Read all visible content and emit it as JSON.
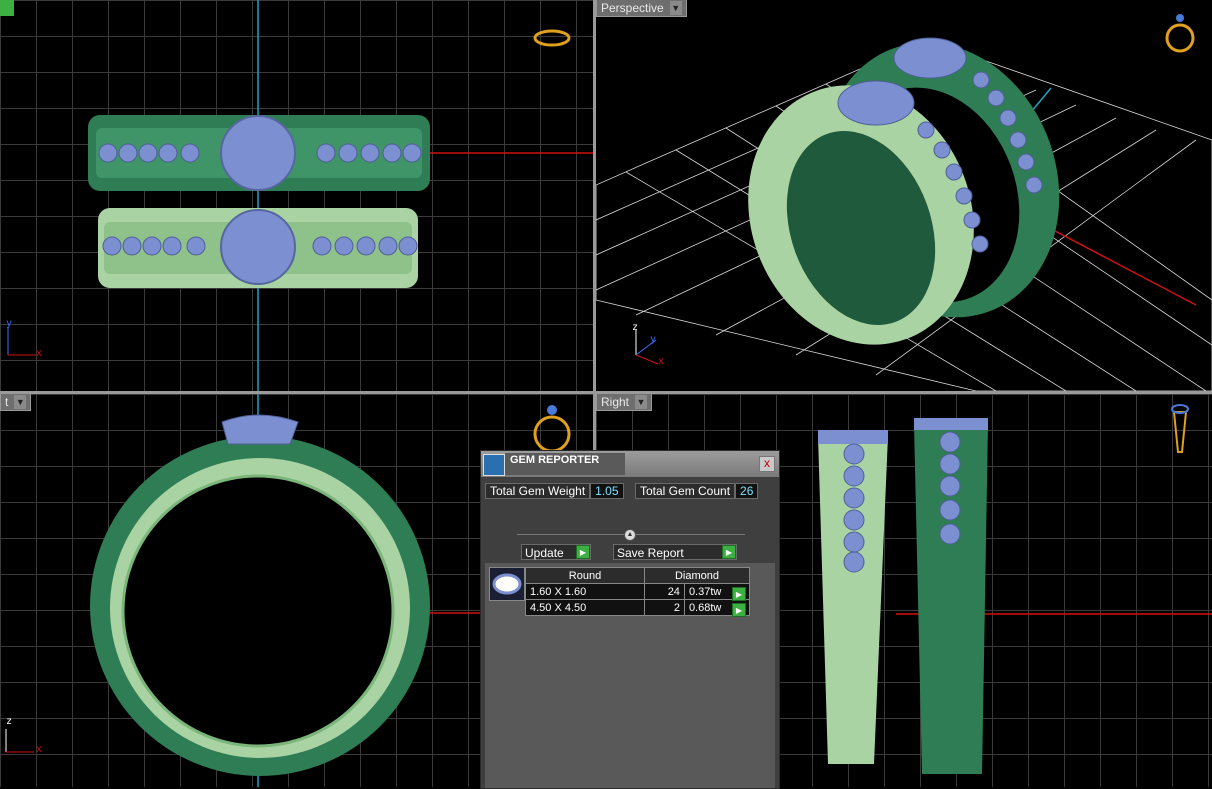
{
  "viewports": {
    "top_left": {
      "label": ""
    },
    "top_right": {
      "label": "Perspective"
    },
    "bottom_left": {
      "label": "t"
    },
    "bottom_right": {
      "label": "Right"
    }
  },
  "axes": {
    "x": "x",
    "y": "y",
    "z": "z"
  },
  "gem_reporter": {
    "title": "GEM REPORTER",
    "close": "x",
    "total_weight_label": "Total Gem Weight",
    "total_weight_value": "1.05",
    "total_count_label": "Total Gem Count",
    "total_count_value": "26",
    "update_label": "Update",
    "save_report_label": "Save Report",
    "table": {
      "headers": [
        "Round",
        "Diamond"
      ],
      "rows": [
        {
          "size": "1.60 X 1.60",
          "count": "24",
          "weight": "0.37tw"
        },
        {
          "size": "4.50 X 4.50",
          "count": "2",
          "weight": "0.68tw"
        }
      ]
    }
  },
  "colors": {
    "ring_dark": "#2e7d55",
    "ring_light": "#a9d3a3",
    "gem": "#7c8fd0",
    "axis_x": "#d01010",
    "axis_y": "#1aa5c0"
  }
}
